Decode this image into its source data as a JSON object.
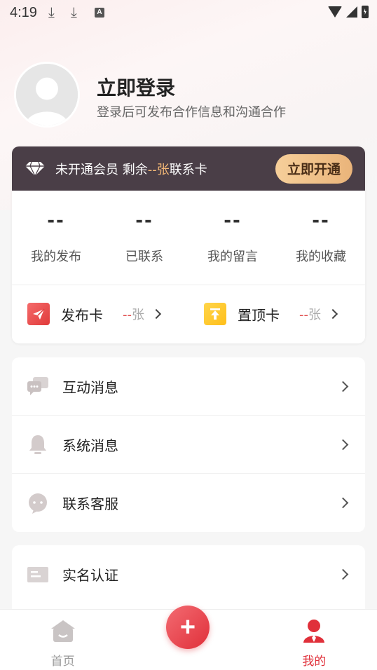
{
  "status_bar": {
    "time": "4:19"
  },
  "profile": {
    "title": "立即登录",
    "subtitle": "登录后可发布合作信息和沟通合作"
  },
  "member": {
    "text_prefix": "未开通会员 剩余",
    "count": "--张",
    "text_suffix": "联系卡",
    "open_button": "立即开通",
    "accent_color": "#f2b776"
  },
  "stats": [
    {
      "value": "--",
      "label": "我的发布"
    },
    {
      "value": "--",
      "label": "已联系"
    },
    {
      "value": "--",
      "label": "我的留言"
    },
    {
      "value": "--",
      "label": "我的收藏"
    }
  ],
  "cards": [
    {
      "label": "发布卡",
      "count_dash": "--",
      "count_unit": "张",
      "icon": "send-icon"
    },
    {
      "label": "置顶卡",
      "count_dash": "--",
      "count_unit": "张",
      "icon": "pin-top-icon"
    }
  ],
  "menu_group_1": [
    {
      "label": "互动消息",
      "icon": "chat-bubbles-icon"
    },
    {
      "label": "系统消息",
      "icon": "bell-icon"
    },
    {
      "label": "联系客服",
      "icon": "customer-service-icon"
    }
  ],
  "menu_group_2": [
    {
      "label": "实名认证",
      "icon": "id-card-icon"
    }
  ],
  "bottom_nav": {
    "home": "首页",
    "add": "+",
    "mine": "我的",
    "active_color": "#e0303a"
  }
}
